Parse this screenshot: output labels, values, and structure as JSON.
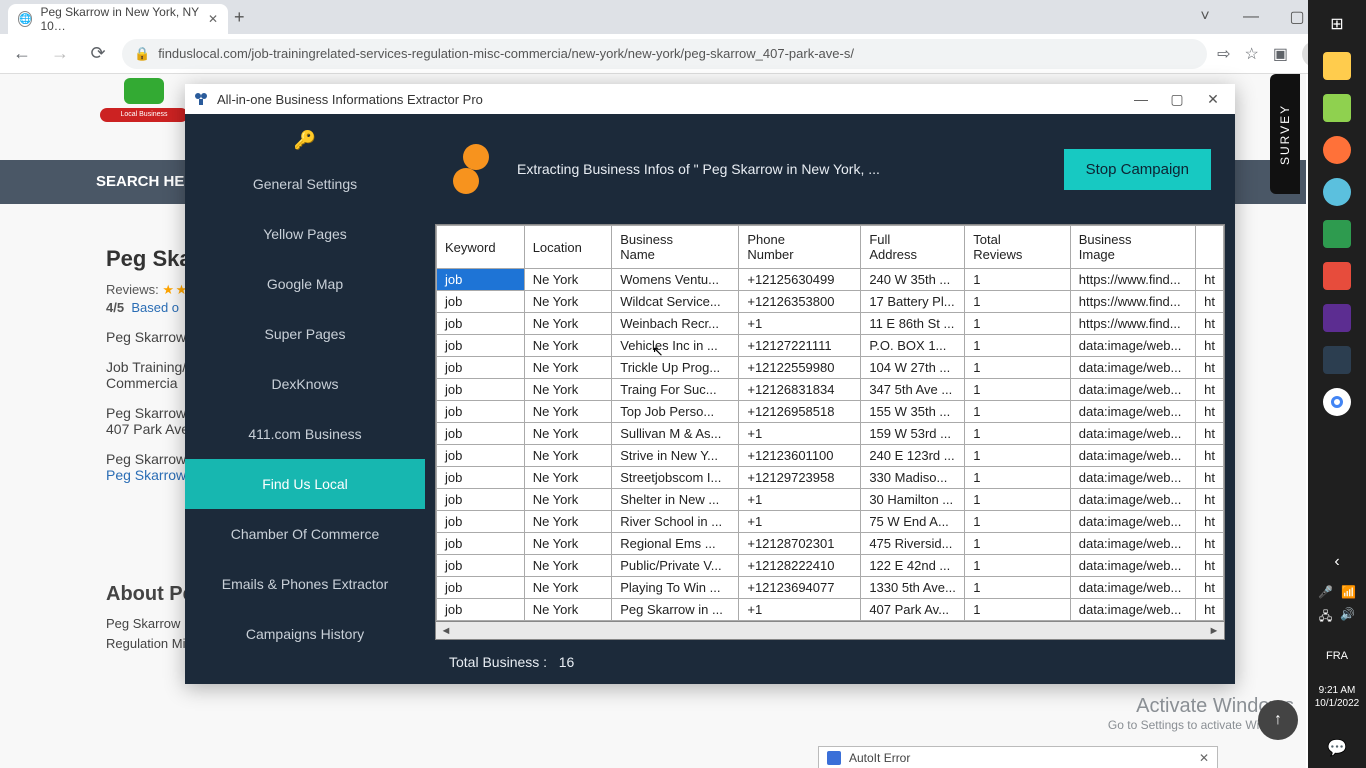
{
  "browser": {
    "tab_title": "Peg Skarrow in New York, NY 10…",
    "url": "finduslocal.com/job-trainingrelated-services-regulation-misc-commercia/new-york/new-york/peg-skarrow_407-park-ave-s/"
  },
  "page": {
    "search_label": "SEARCH HER",
    "title": "Peg Skar",
    "reviews_label": "Reviews:",
    "score": "4/5",
    "based": "Based o",
    "name_line": "Peg Skarrow",
    "cat_line1": "Job Training/",
    "cat_line2": "Commercia",
    "addr_name": "Peg Skarrow",
    "addr_line": "407 Park Ave",
    "link_name": "Peg Skarrow",
    "link_text": "Peg Skarrow",
    "about_title": "About Pe",
    "about_body": "Peg Skarrow … operates in … well as other possible related aspects and functions of Job Training/related Services Regulation Misc …",
    "survey": "SURVEY"
  },
  "app": {
    "title": "All-in-one Business Informations Extractor Pro",
    "sidebar": {
      "items": [
        {
          "label": "General Settings"
        },
        {
          "label": "Yellow Pages"
        },
        {
          "label": "Google Map"
        },
        {
          "label": "Super Pages"
        },
        {
          "label": "DexKnows"
        },
        {
          "label": "411.com Business"
        },
        {
          "label": "Find Us Local",
          "active": true
        },
        {
          "label": "Chamber Of Commerce"
        },
        {
          "label": "Emails & Phones Extractor"
        },
        {
          "label": "Campaigns History"
        }
      ]
    },
    "status": "Extracting Business Infos of \" Peg Skarrow in New York, ...",
    "stop_label": "Stop Campaign",
    "columns": [
      "Keyword",
      "Location",
      "Business Name",
      "Phone Number",
      "Full Address",
      "Total Reviews",
      "Business Image",
      ""
    ],
    "rows": [
      {
        "kw": "job",
        "loc": "Ne York",
        "name": "Womens Ventu...",
        "phone": "+12125630499",
        "addr": "240 W 35th ...",
        "rev": "1",
        "img": "https://www.find...",
        "x": "ht"
      },
      {
        "kw": "job",
        "loc": "Ne York",
        "name": "Wildcat Service...",
        "phone": "+12126353800",
        "addr": "17 Battery Pl...",
        "rev": "1",
        "img": "https://www.find...",
        "x": "ht"
      },
      {
        "kw": "job",
        "loc": "Ne York",
        "name": "Weinbach Recr...",
        "phone": "+1",
        "addr": "11 E 86th St ...",
        "rev": "1",
        "img": "https://www.find...",
        "x": "ht"
      },
      {
        "kw": "job",
        "loc": "Ne York",
        "name": "Vehicles Inc in ...",
        "phone": "+12127221111",
        "addr": "P.O. BOX 1...",
        "rev": "1",
        "img": "data:image/web...",
        "x": "ht"
      },
      {
        "kw": "job",
        "loc": "Ne York",
        "name": "Trickle Up Prog...",
        "phone": "+12122559980",
        "addr": "104 W 27th ...",
        "rev": "1",
        "img": "data:image/web...",
        "x": "ht"
      },
      {
        "kw": "job",
        "loc": "Ne York",
        "name": "Traing For Suc...",
        "phone": "+12126831834",
        "addr": "347 5th Ave ...",
        "rev": "1",
        "img": "data:image/web...",
        "x": "ht"
      },
      {
        "kw": "job",
        "loc": "Ne York",
        "name": "Top Job Perso...",
        "phone": "+12126958518",
        "addr": "155 W 35th ...",
        "rev": "1",
        "img": "data:image/web...",
        "x": "ht"
      },
      {
        "kw": "job",
        "loc": "Ne York",
        "name": "Sullivan M & As...",
        "phone": "+1",
        "addr": "159 W 53rd ...",
        "rev": "1",
        "img": "data:image/web...",
        "x": "ht"
      },
      {
        "kw": "job",
        "loc": "Ne York",
        "name": "Strive in New Y...",
        "phone": "+12123601100",
        "addr": "240 E 123rd ...",
        "rev": "1",
        "img": "data:image/web...",
        "x": "ht"
      },
      {
        "kw": "job",
        "loc": "Ne York",
        "name": "Streetjobscom I...",
        "phone": "+12129723958",
        "addr": "330 Madiso...",
        "rev": "1",
        "img": "data:image/web...",
        "x": "ht"
      },
      {
        "kw": "job",
        "loc": "Ne York",
        "name": "Shelter in New ...",
        "phone": "+1",
        "addr": "30 Hamilton ...",
        "rev": "1",
        "img": "data:image/web...",
        "x": "ht"
      },
      {
        "kw": "job",
        "loc": "Ne York",
        "name": "River School in ...",
        "phone": "+1",
        "addr": "75 W End A...",
        "rev": "1",
        "img": "data:image/web...",
        "x": "ht"
      },
      {
        "kw": "job",
        "loc": "Ne York",
        "name": "Regional Ems ...",
        "phone": "+12128702301",
        "addr": "475 Riversid...",
        "rev": "1",
        "img": "data:image/web...",
        "x": "ht"
      },
      {
        "kw": "job",
        "loc": "Ne York",
        "name": "Public/Private V...",
        "phone": "+12128222410",
        "addr": "122 E 42nd ...",
        "rev": "1",
        "img": "data:image/web...",
        "x": "ht"
      },
      {
        "kw": "job",
        "loc": "Ne York",
        "name": "Playing To Win ...",
        "phone": "+12123694077",
        "addr": "1330 5th Ave...",
        "rev": "1",
        "img": "data:image/web...",
        "x": "ht"
      },
      {
        "kw": "job",
        "loc": "Ne York",
        "name": "Peg Skarrow in ...",
        "phone": "+1",
        "addr": "407 Park Av...",
        "rev": "1",
        "img": "data:image/web...",
        "x": "ht"
      }
    ],
    "total_label": "Total Business :",
    "total_value": "16"
  },
  "os": {
    "watermark_title": "Activate Windows",
    "watermark_sub": "Go to Settings to activate Windows",
    "autoit_title": "AutoIt Error",
    "lang": "FRA",
    "time": "9:21 AM",
    "date": "10/1/2022"
  }
}
